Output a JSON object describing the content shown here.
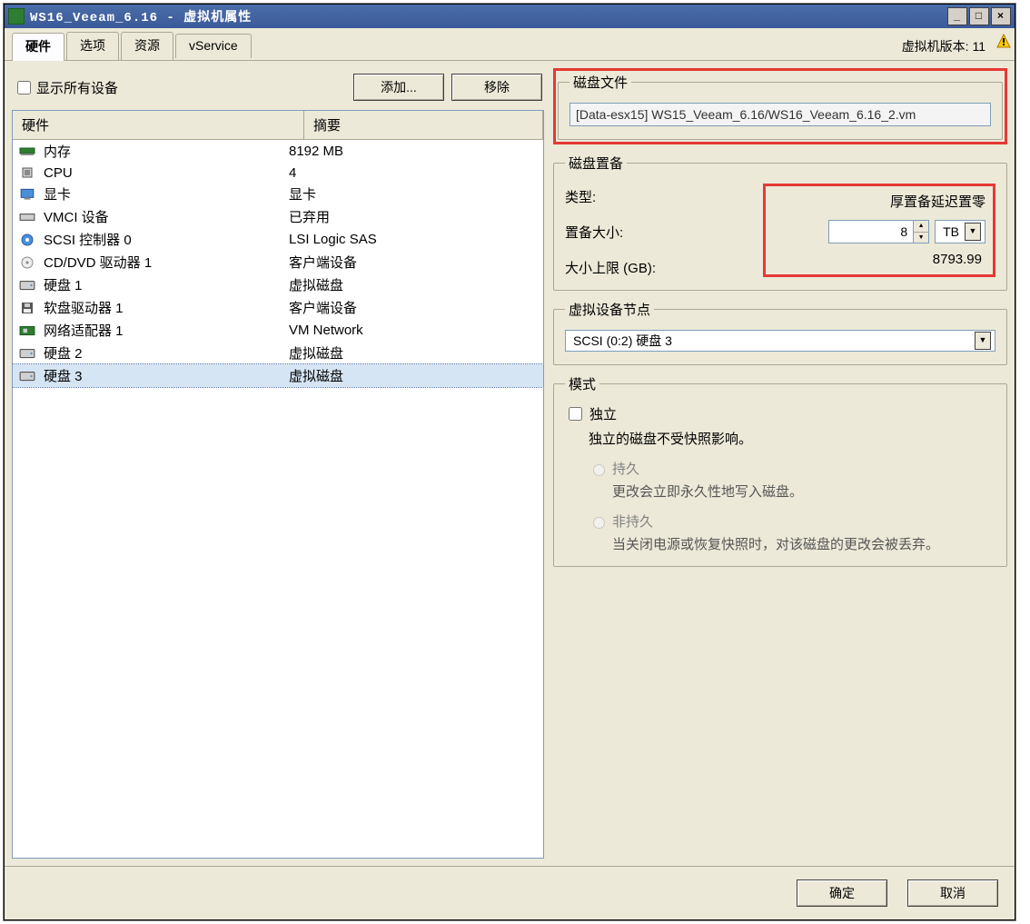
{
  "title": "WS16_Veeam_6.16 - 虚拟机属性",
  "vm_version": "虚拟机版本: 11",
  "tabs": [
    "硬件",
    "选项",
    "资源",
    "vService"
  ],
  "active_tab": 0,
  "show_all_devices_label": "显示所有设备",
  "buttons": {
    "add": "添加...",
    "remove": "移除",
    "ok": "确定",
    "cancel": "取消"
  },
  "table_headers": {
    "hardware": "硬件",
    "summary": "摘要"
  },
  "devices": [
    {
      "icon": "memory",
      "name": "内存",
      "summary": "8192 MB"
    },
    {
      "icon": "cpu",
      "name": "CPU",
      "summary": "4"
    },
    {
      "icon": "video",
      "name": "显卡",
      "summary": "显卡"
    },
    {
      "icon": "vmci",
      "name": "VMCI 设备",
      "summary": "已弃用"
    },
    {
      "icon": "scsi",
      "name": "SCSI 控制器 0",
      "summary": "LSI Logic SAS"
    },
    {
      "icon": "cd",
      "name": "CD/DVD 驱动器 1",
      "summary": "客户端设备"
    },
    {
      "icon": "disk",
      "name": "硬盘 1",
      "summary": "虚拟磁盘"
    },
    {
      "icon": "floppy",
      "name": "软盘驱动器 1",
      "summary": "客户端设备"
    },
    {
      "icon": "nic",
      "name": "网络适配器 1",
      "summary": "VM Network"
    },
    {
      "icon": "disk",
      "name": "硬盘 2",
      "summary": "虚拟磁盘"
    },
    {
      "icon": "disk",
      "name": "硬盘 3",
      "summary": "虚拟磁盘",
      "selected": true
    }
  ],
  "disk_file": {
    "legend": "磁盘文件",
    "path": "[Data-esx15] WS15_Veeam_6.16/WS16_Veeam_6.16_2.vm"
  },
  "provisioning": {
    "legend": "磁盘置备",
    "type_label": "类型:",
    "type_value": "厚置备延迟置零",
    "size_label": "置备大小:",
    "size_value": "8",
    "size_unit": "TB",
    "max_label": "大小上限 (GB):",
    "max_value": "8793.99"
  },
  "device_node": {
    "legend": "虚拟设备节点",
    "value": "SCSI (0:2) 硬盘 3"
  },
  "mode": {
    "legend": "模式",
    "independent_label": "独立",
    "independent_note": "独立的磁盘不受快照影响。",
    "persistent_label": "持久",
    "persistent_note": "更改会立即永久性地写入磁盘。",
    "nonpersistent_label": "非持久",
    "nonpersistent_note": "当关闭电源或恢复快照时，对该磁盘的更改会被丢弃。"
  }
}
